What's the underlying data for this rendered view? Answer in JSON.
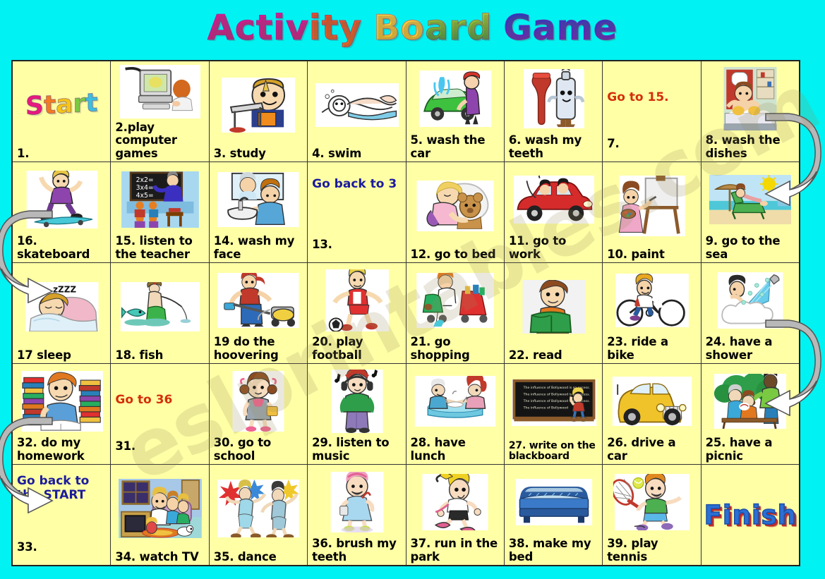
{
  "page": {
    "background_color": "#00F2F2",
    "cell_color": "#FFFFA6",
    "border_color": "#222222"
  },
  "title": {
    "full": "Activity Board Game",
    "parts": [
      {
        "text": "Activ",
        "color": "#E0189A"
      },
      {
        "text": "ity",
        "color": "#E84B2A"
      },
      {
        "text": "Bo",
        "color": "#FBD14B"
      },
      {
        "text": "ard",
        "color": "#8FBF2A"
      },
      {
        "text": "Game",
        "color": "#1740C8"
      }
    ]
  },
  "board": {
    "columns": 8,
    "rows": 5,
    "start_label": "Start",
    "finish_label": "Finish",
    "rows_data": [
      {
        "direction": "left-to-right",
        "cells": [
          {
            "number": "1.",
            "label": "1.",
            "wordart": "Start",
            "icon": "start-wordart",
            "instruction": ""
          },
          {
            "number": "2",
            "label": "2.play computer games",
            "icon": "computer-icon",
            "instruction": ""
          },
          {
            "number": "3",
            "label": "3. study",
            "icon": "study-desk-icon",
            "instruction": ""
          },
          {
            "number": "4",
            "label": "4. swim",
            "icon": "swimmer-icon",
            "instruction": ""
          },
          {
            "number": "5",
            "label": "5. wash the car",
            "icon": "car-wash-icon",
            "instruction": ""
          },
          {
            "number": "6",
            "label": "6. wash my teeth",
            "icon": "toothbrush-icon",
            "instruction": ""
          },
          {
            "number": "7.",
            "label": "7.",
            "icon": "none",
            "instruction": "Go to 15.",
            "instruction_color": "red"
          },
          {
            "number": "8",
            "label": "8. wash the dishes",
            "icon": "dishwashing-icon",
            "instruction": ""
          }
        ]
      },
      {
        "direction": "right-to-left",
        "cells": [
          {
            "number": "16",
            "label": "16. skateboard",
            "icon": "skateboard-icon",
            "instruction": ""
          },
          {
            "number": "15",
            "label": "15.  listen to the teacher",
            "icon": "teacher-blackboard-icon",
            "instruction": ""
          },
          {
            "number": "14",
            "label": "14. wash my face",
            "icon": "wash-face-icon",
            "instruction": ""
          },
          {
            "number": "13.",
            "label": "13.",
            "icon": "none",
            "instruction": "Go back to 3",
            "instruction_color": "blue"
          },
          {
            "number": "12",
            "label": "12. go to bed",
            "icon": "sleeping-child-teddy-icon",
            "instruction": ""
          },
          {
            "number": "11",
            "label": "11. go to work",
            "icon": "red-car-icon",
            "instruction": ""
          },
          {
            "number": "10",
            "label": "10. paint",
            "icon": "easel-painter-icon",
            "instruction": ""
          },
          {
            "number": "9",
            "label": "9. go to the sea",
            "icon": "beach-lounger-icon",
            "instruction": ""
          }
        ]
      },
      {
        "direction": "left-to-right",
        "cells": [
          {
            "number": "17",
            "label": "17 sleep",
            "icon": "sleeping-man-icon",
            "instruction": ""
          },
          {
            "number": "18",
            "label": "18. fish",
            "icon": "fishing-icon",
            "instruction": ""
          },
          {
            "number": "19",
            "label": "19 do the hoovering",
            "icon": "vacuum-cleaner-icon",
            "instruction": ""
          },
          {
            "number": "20",
            "label": "20. play football",
            "icon": "footballer-icon",
            "instruction": ""
          },
          {
            "number": "21",
            "label": "21. go shopping",
            "icon": "shopping-cart-icon",
            "instruction": ""
          },
          {
            "number": "22",
            "label": "22. read",
            "icon": "reading-boy-icon",
            "instruction": ""
          },
          {
            "number": "23",
            "label": "23.   ride a bike",
            "icon": "bicycle-icon",
            "instruction": ""
          },
          {
            "number": "24",
            "label": "24. have a shower",
            "icon": "shower-icon",
            "instruction": ""
          }
        ]
      },
      {
        "direction": "right-to-left",
        "cells": [
          {
            "number": "32",
            "label": "32. do my homework",
            "icon": "homework-books-icon",
            "instruction": ""
          },
          {
            "number": "31.",
            "label": "31.",
            "icon": "none",
            "instruction": "Go to 36",
            "instruction_color": "red"
          },
          {
            "number": "30",
            "label": "30. go to school",
            "icon": "schoolgirl-icon",
            "instruction": ""
          },
          {
            "number": "29",
            "label": "29. listen to music",
            "icon": "headphones-kid-icon",
            "instruction": ""
          },
          {
            "number": "28",
            "label": "28. have lunch",
            "icon": "lunch-table-icon",
            "instruction": ""
          },
          {
            "number": "27",
            "label": "27. write on the blackboard",
            "icon": "write-blackboard-icon",
            "instruction": "",
            "small_label": true
          },
          {
            "number": "26",
            "label": "26. drive a car",
            "icon": "yellow-car-icon",
            "instruction": ""
          },
          {
            "number": "25",
            "label": "25. have a picnic",
            "icon": "picnic-icon",
            "instruction": ""
          }
        ]
      },
      {
        "direction": "left-to-right",
        "cells": [
          {
            "number": "33.",
            "label": "33.",
            "icon": "none",
            "instruction": "Go back to the START",
            "instruction_color": "blue"
          },
          {
            "number": "34",
            "label": "34. watch TV",
            "icon": "family-tv-icon",
            "instruction": ""
          },
          {
            "number": "35",
            "label": "35. dance",
            "icon": "dancers-icon",
            "instruction": ""
          },
          {
            "number": "36",
            "label": "36.  brush my teeth",
            "icon": "brush-teeth-girl-icon",
            "instruction": ""
          },
          {
            "number": "37",
            "label": "37. run in the park",
            "icon": "running-girl-icon",
            "instruction": ""
          },
          {
            "number": "38",
            "label": "38. make my bed",
            "icon": "blue-bed-icon",
            "instruction": ""
          },
          {
            "number": "39",
            "label": "39. play tennis",
            "icon": "tennis-boy-icon",
            "instruction": ""
          },
          {
            "number": "",
            "label": "",
            "wordart": "Finish",
            "icon": "finish-wordart",
            "instruction": ""
          }
        ]
      }
    ]
  },
  "arrows": [
    {
      "name": "arrow-row1-to-row2",
      "side": "right"
    },
    {
      "name": "arrow-row2-to-row3",
      "side": "left"
    },
    {
      "name": "arrow-row3-to-row4",
      "side": "right"
    },
    {
      "name": "arrow-row4-to-row5",
      "side": "left"
    }
  ],
  "watermark": {
    "text": "eslprintables.com"
  }
}
